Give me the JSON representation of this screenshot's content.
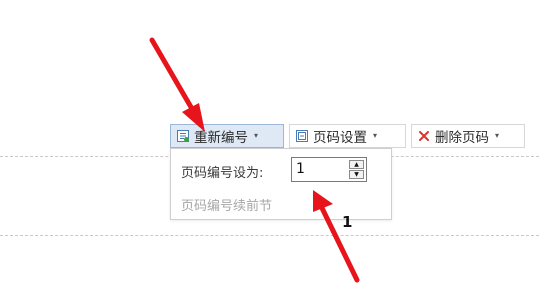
{
  "toolbar": {
    "renumber_label": "重新编号",
    "page_settings_label": "页码设置",
    "delete_label": "删除页码",
    "caret": "▾"
  },
  "renumber_panel": {
    "set_label": "页码编号设为:",
    "value": "1",
    "continue_label": "页码编号续前节"
  },
  "page_number": "1",
  "colors": {
    "annotation_arrow": "#e8141b",
    "active_button_bg": "#dfe9f6",
    "delete_icon": "#d9362b",
    "icon_accent": "#2f6fbd"
  }
}
